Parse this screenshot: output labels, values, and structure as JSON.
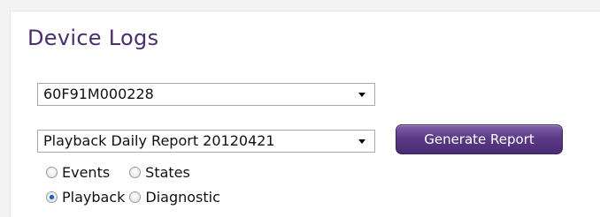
{
  "title": "Device Logs",
  "device_select": {
    "value": "60F91M000228"
  },
  "report_select": {
    "value": "Playback Daily Report 20120421"
  },
  "generate_button": {
    "label": "Generate Report"
  },
  "radios": {
    "events": {
      "label": "Events",
      "checked": false
    },
    "states": {
      "label": "States",
      "checked": false
    },
    "playback": {
      "label": "Playback",
      "checked": true
    },
    "diagnostic": {
      "label": "Diagnostic",
      "checked": false
    }
  },
  "colors": {
    "title": "#4a2f6d",
    "button": "#5b3b86",
    "radio_dot": "#1f5fbf"
  }
}
